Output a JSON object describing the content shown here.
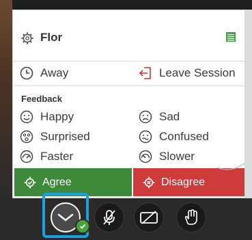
{
  "header": {
    "user_name": "Flor"
  },
  "status": {
    "away_label": "Away",
    "leave_label": "Leave Session"
  },
  "feedback": {
    "section_label": "Feedback",
    "items": [
      {
        "label": "Happy",
        "icon": "happy-face-icon"
      },
      {
        "label": "Sad",
        "icon": "sad-face-icon"
      },
      {
        "label": "Surprised",
        "icon": "surprised-face-icon"
      },
      {
        "label": "Confused",
        "icon": "confused-face-icon"
      },
      {
        "label": "Faster",
        "icon": "faster-icon"
      },
      {
        "label": "Slower",
        "icon": "slower-icon"
      }
    ],
    "agree_label": "Agree",
    "disagree_label": "Disagree"
  },
  "colors": {
    "agree": "#3f8a3a",
    "disagree": "#cf3a3a",
    "highlight": "#1ba0e0",
    "check_badge": "#47a23f",
    "list_icon": "#3aa540"
  },
  "controls": [
    {
      "name": "my-status-control",
      "icon": "chevron-down-icon"
    },
    {
      "name": "microphone-button",
      "icon": "microphone-muted-icon"
    },
    {
      "name": "camera-button",
      "icon": "camera-off-icon"
    },
    {
      "name": "raise-hand-button",
      "icon": "hand-icon"
    }
  ]
}
